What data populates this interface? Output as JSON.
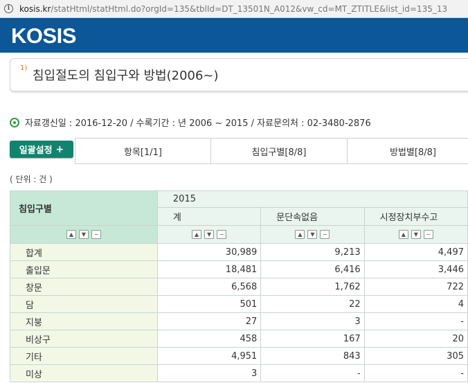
{
  "url_bar": {
    "host": "kosis.kr",
    "path": "/statHtml/statHtml.do?orgId=135&tblId=DT_13501N_A012&vw_cd=MT_ZTITLE&list_id=135_13"
  },
  "header": {
    "logo": "KOSIS",
    "bg_color": "#0b5797"
  },
  "title_box": {
    "footnote": "1)",
    "title": "침입절도의 침입구와 방법(2006~)"
  },
  "meta": {
    "text": "자료갱신일 : 2016-12-20 / 수록기간 : 년 2006 ~ 2015 / 자료문의처 : 02-3480-2876"
  },
  "toolbar": {
    "bulk_button": "일괄설정",
    "bulk_plus": "+",
    "tabs": [
      {
        "label": "항목[1/1]"
      },
      {
        "label": "침입구별[8/8]"
      },
      {
        "label": "방법별[8/8]"
      }
    ]
  },
  "unit": "( 단위 : 건 )",
  "table": {
    "corner_header": "침입구별",
    "year": "2015",
    "columns": [
      "계",
      "문단속없음",
      "시정장치부수고"
    ],
    "rows": [
      {
        "label": "합계",
        "values": [
          "30,989",
          "9,213",
          "4,497"
        ]
      },
      {
        "label": "출입문",
        "values": [
          "18,481",
          "6,416",
          "3,446"
        ]
      },
      {
        "label": "창문",
        "values": [
          "6,568",
          "1,762",
          "722"
        ]
      },
      {
        "label": "담",
        "values": [
          "501",
          "22",
          "4"
        ]
      },
      {
        "label": "지붕",
        "values": [
          "27",
          "3",
          "-"
        ]
      },
      {
        "label": "비상구",
        "values": [
          "458",
          "167",
          "20"
        ]
      },
      {
        "label": "기타",
        "values": [
          "4,951",
          "843",
          "305"
        ]
      },
      {
        "label": "미상",
        "values": [
          "3",
          "-",
          "-"
        ]
      }
    ]
  },
  "colors": {
    "accent_green": "#13836f",
    "header_green": "#c7e8d7",
    "row_label_bg": "#f3f8e6"
  }
}
